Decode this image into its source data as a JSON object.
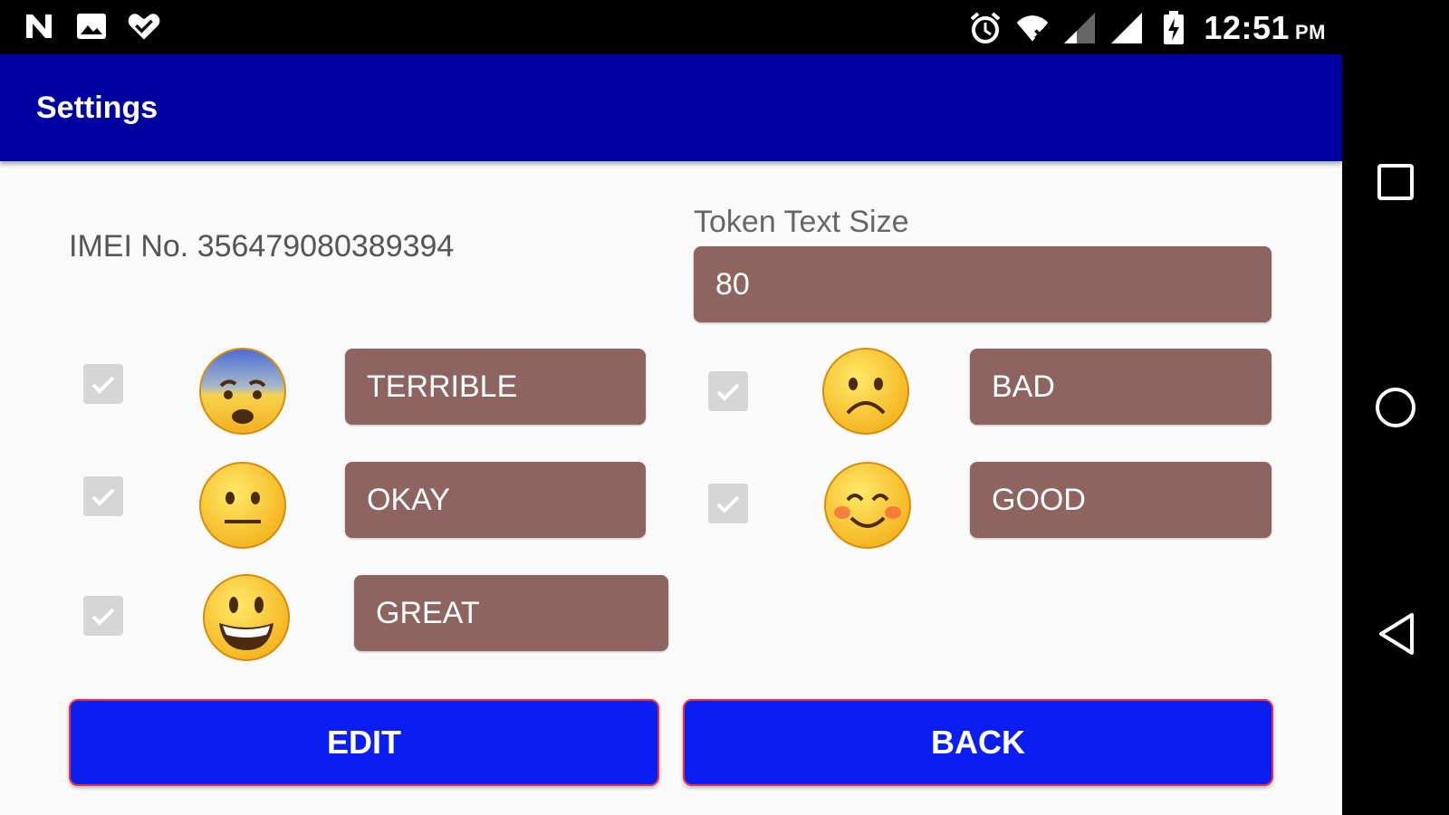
{
  "status_bar": {
    "left_icons": [
      "n-notification-icon",
      "image-icon",
      "heart-check-icon"
    ],
    "right_icons": [
      "alarm-icon",
      "wifi-x-icon",
      "signal-weak-icon",
      "signal-full-icon",
      "battery-charging-icon"
    ],
    "time": "12:51",
    "ampm": "PM"
  },
  "toolbar": {
    "title": "Settings"
  },
  "imei": "IMEI No. 356479080389394",
  "token": {
    "label": "Token Text Size",
    "value": "80"
  },
  "moods": [
    {
      "id": "terrible",
      "label": "TERRIBLE",
      "checked": true,
      "icon": "fearful-face-icon"
    },
    {
      "id": "bad",
      "label": "BAD",
      "checked": true,
      "icon": "frowning-face-icon"
    },
    {
      "id": "okay",
      "label": "OKAY",
      "checked": true,
      "icon": "neutral-face-icon"
    },
    {
      "id": "good",
      "label": "GOOD",
      "checked": true,
      "icon": "smiling-face-icon"
    },
    {
      "id": "great",
      "label": "GREAT",
      "checked": true,
      "icon": "grinning-face-icon"
    }
  ],
  "buttons": {
    "edit": "EDIT",
    "back": "BACK"
  },
  "colors": {
    "toolbar": "#0000a0",
    "field": "#8d6460",
    "button": "#0a1ef0",
    "button_border": "#e0304a"
  },
  "nav": {
    "icons": [
      "recents-square-icon",
      "home-circle-icon",
      "back-triangle-icon"
    ]
  }
}
